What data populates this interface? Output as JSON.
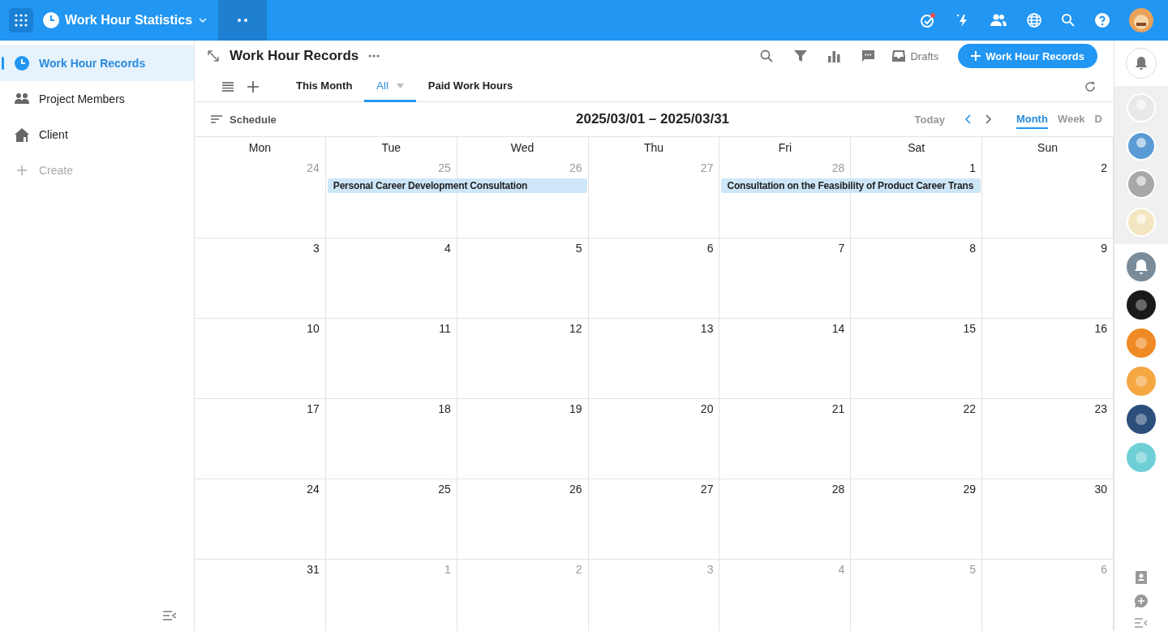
{
  "app": {
    "title": "Work Hour Statistics"
  },
  "sidebar": {
    "items": [
      {
        "label": "Work Hour Records",
        "kind": "clock",
        "selected": true
      },
      {
        "label": "Project Members",
        "kind": "people",
        "selected": false
      },
      {
        "label": "Client",
        "kind": "house",
        "selected": false
      }
    ],
    "create": "Create"
  },
  "header": {
    "title": "Work Hour Records",
    "drafts": "Drafts",
    "add_button": "Work Hour Records"
  },
  "views": [
    {
      "label": "This Month",
      "selected": false,
      "dropdown": false
    },
    {
      "label": "All",
      "selected": true,
      "dropdown": true
    },
    {
      "label": "Paid Work Hours",
      "selected": false,
      "dropdown": false
    }
  ],
  "toolbar": {
    "schedule": "Schedule",
    "range": "2025/03/01 – 2025/03/31",
    "today": "Today",
    "modes": [
      {
        "label": "Month",
        "selected": true
      },
      {
        "label": "Week",
        "selected": false
      },
      {
        "label": "D",
        "selected": false
      }
    ]
  },
  "weekdays": [
    "Mon",
    "Tue",
    "Wed",
    "Thu",
    "Fri",
    "Sat",
    "Sun"
  ],
  "weeks": [
    {
      "days": [
        {
          "date": "24",
          "outside": true
        },
        {
          "date": "25",
          "outside": true,
          "event": "Personal Career Development Consultation"
        },
        {
          "date": "26",
          "outside": true,
          "continues": true
        },
        {
          "date": "27",
          "outside": true
        },
        {
          "date": "28",
          "outside": true,
          "event": "Consultation on the Feasibility of Product Career Trans"
        },
        {
          "date": "1",
          "outside": false,
          "continues": true
        },
        {
          "date": "2",
          "outside": false
        }
      ]
    },
    {
      "days": [
        {
          "date": "3",
          "outside": false
        },
        {
          "date": "4",
          "outside": false
        },
        {
          "date": "5",
          "outside": false
        },
        {
          "date": "6",
          "outside": false
        },
        {
          "date": "7",
          "outside": false
        },
        {
          "date": "8",
          "outside": false
        },
        {
          "date": "9",
          "outside": false
        }
      ]
    },
    {
      "days": [
        {
          "date": "10",
          "outside": false
        },
        {
          "date": "11",
          "outside": false
        },
        {
          "date": "12",
          "outside": false
        },
        {
          "date": "13",
          "outside": false
        },
        {
          "date": "14",
          "outside": false
        },
        {
          "date": "15",
          "outside": false
        },
        {
          "date": "16",
          "outside": false
        }
      ]
    },
    {
      "days": [
        {
          "date": "17",
          "outside": false
        },
        {
          "date": "18",
          "outside": false
        },
        {
          "date": "19",
          "outside": false
        },
        {
          "date": "20",
          "outside": false
        },
        {
          "date": "21",
          "outside": false
        },
        {
          "date": "22",
          "outside": false
        },
        {
          "date": "23",
          "outside": false
        }
      ]
    },
    {
      "days": [
        {
          "date": "24",
          "outside": false
        },
        {
          "date": "25",
          "outside": false
        },
        {
          "date": "26",
          "outside": false
        },
        {
          "date": "27",
          "outside": false
        },
        {
          "date": "28",
          "outside": false
        },
        {
          "date": "29",
          "outside": false
        },
        {
          "date": "30",
          "outside": false
        }
      ]
    },
    {
      "days": [
        {
          "date": "31",
          "outside": false
        },
        {
          "date": "1",
          "outside": true
        },
        {
          "date": "2",
          "outside": true
        },
        {
          "date": "3",
          "outside": true
        },
        {
          "date": "4",
          "outside": true
        },
        {
          "date": "5",
          "outside": true
        },
        {
          "date": "6",
          "outside": true
        }
      ]
    }
  ]
}
